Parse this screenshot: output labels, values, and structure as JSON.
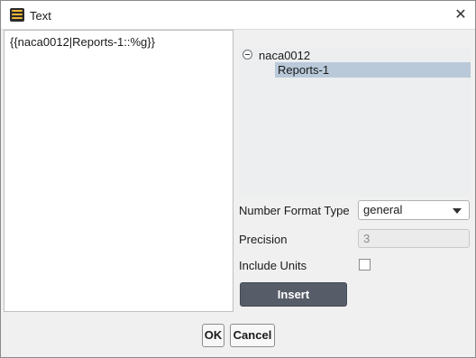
{
  "window": {
    "title": "Text",
    "close_glyph": "✕"
  },
  "editor": {
    "value": "{{naca0012|Reports-1::%g}}"
  },
  "tree": {
    "root": "naca0012",
    "child": "Reports-1"
  },
  "form": {
    "number_format_label": "Number Format Type",
    "number_format_value": "general",
    "precision_label": "Precision",
    "precision_value": "3",
    "include_units_label": "Include Units",
    "include_units_checked": false,
    "insert_label": "Insert"
  },
  "buttons": {
    "ok": "OK",
    "cancel": "Cancel"
  },
  "colors": {
    "selection": "#b9c9d9",
    "insert_button": "#565d68",
    "tree_bg": "#eceeef"
  },
  "icons": {
    "app": "fluent-app-icon",
    "close": "close-icon",
    "tree_toggle": "collapse-minus-icon",
    "dropdown": "chevron-down-icon"
  }
}
